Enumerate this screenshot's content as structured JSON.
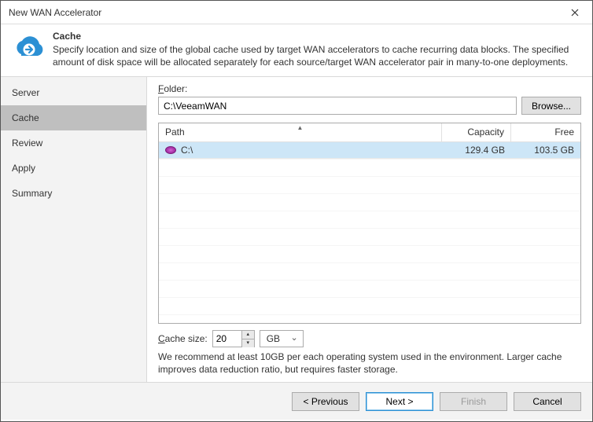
{
  "window": {
    "title": "New WAN Accelerator"
  },
  "header": {
    "title": "Cache",
    "description": "Specify location and size of the global cache used by target WAN accelerators to cache recurring data blocks. The specified amount of disk space will be allocated separately for each source/target WAN accelerator pair in many-to-one deployments."
  },
  "sidebar": {
    "items": [
      {
        "label": "Server"
      },
      {
        "label": "Cache"
      },
      {
        "label": "Review"
      },
      {
        "label": "Apply"
      },
      {
        "label": "Summary"
      }
    ],
    "active_index": 1
  },
  "main": {
    "folder_label": "Folder:",
    "folder_value": "C:\\VeeamWAN",
    "browse_label": "Browse...",
    "grid": {
      "columns": {
        "path": "Path",
        "capacity": "Capacity",
        "free": "Free"
      },
      "rows": [
        {
          "path": "C:\\",
          "capacity": "129.4 GB",
          "free": "103.5 GB"
        }
      ]
    },
    "cache_size_label": "Cache size:",
    "cache_size_value": "20",
    "cache_size_unit": "GB",
    "hint": "We recommend at least 10GB per each operating system used in the environment. Larger cache improves data reduction ratio, but requires faster storage."
  },
  "footer": {
    "previous": "< Previous",
    "next": "Next >",
    "finish": "Finish",
    "cancel": "Cancel"
  }
}
